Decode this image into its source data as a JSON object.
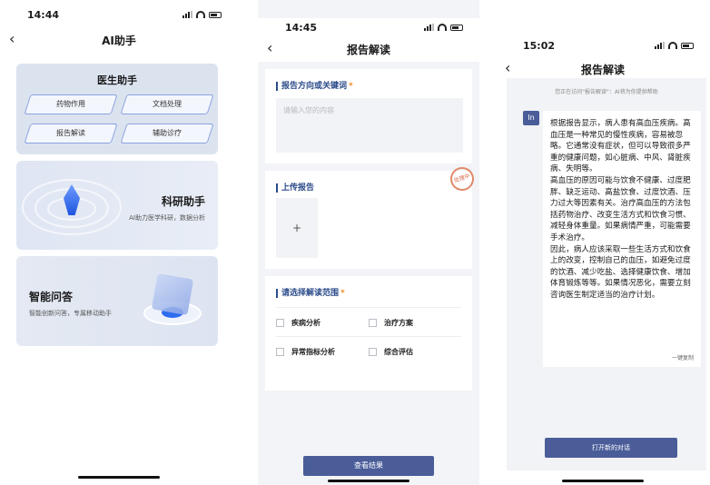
{
  "phone1": {
    "status": {
      "time": "14:44"
    },
    "nav": {
      "title": "AI助手"
    },
    "doctor_card": {
      "title": "医生助手",
      "buttons": [
        "药物作用",
        "文档处理",
        "报告解读",
        "辅助诊疗"
      ]
    },
    "research_card": {
      "title": "科研助手",
      "subtitle": "AI助力医学科研，数据分析"
    },
    "qa_card": {
      "title": "智能问答",
      "subtitle": "智能创新问答，专属移动助手"
    }
  },
  "phone2": {
    "status": {
      "time": "14:45"
    },
    "nav": {
      "title": "报告解读"
    },
    "keyword": {
      "label": "报告方向或关键词",
      "required_mark": "*",
      "placeholder": "请输入您的内容"
    },
    "upload": {
      "label": "上传报告",
      "add_glyph": "+",
      "stamp_text": "处理中"
    },
    "scope": {
      "label": "请选择解读范围",
      "required_mark": "*",
      "options": [
        "疾病分析",
        "治疗方案",
        "异常指标分析",
        "综合评估"
      ]
    },
    "submit_label": "查看结果"
  },
  "phone3": {
    "status": {
      "time": "15:02"
    },
    "nav": {
      "title": "报告解读"
    },
    "notice": "您正在访问\"报告解读\"：AI将为你提供帮助",
    "avatar_text": "In",
    "message": [
      "根据报告显示，病人患有高血压疾病。高血压是一种常见的慢性疾病，容易被忽略。它通常没有症状，但可以导致很多严重的健康问题，如心脏病、中风、肾脏疾病、失明等。",
      "高血压的原因可能与饮食不健康、过度肥胖、缺乏运动、高盐饮食、过度饮酒、压力过大等因素有关。治疗高血压的方法包括药物治疗、改变生活方式和饮食习惯、减轻身体重量。如果病情严重，可能需要手术治疗。",
      "因此，病人应该采取一些生活方式和饮食上的改变，控制自己的血压，如避免过度的饮酒、减少吃盐、选择健康饮食、增加体育锻炼等等。如果情况恶化，需要立刻咨询医生制定适当的治疗计划。"
    ],
    "copy_label": "一键复制",
    "new_chat_label": "打开新的对话"
  },
  "colors": {
    "accent": "#4a5d99",
    "label": "#2b4a8a",
    "required": "#f08c2b",
    "card_bg": "#dbe3ef"
  },
  "icons": [
    "back-arrow-icon",
    "signal-icon",
    "wifi-icon",
    "battery-icon",
    "plus-icon"
  ]
}
